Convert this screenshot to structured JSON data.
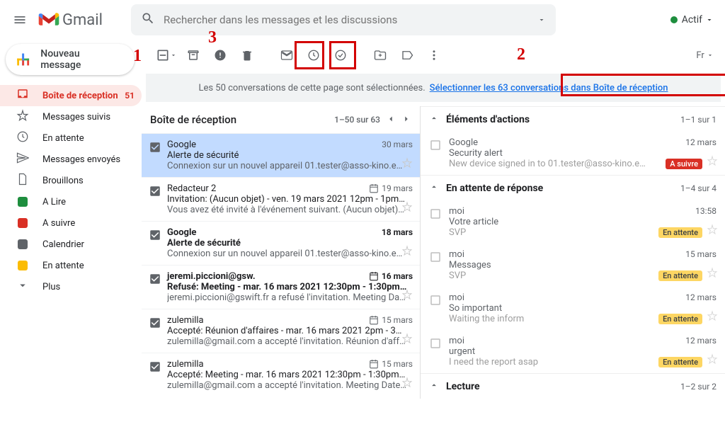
{
  "header": {
    "product": "Gmail",
    "search_placeholder": "Rechercher dans les messages et les discussions",
    "status_label": "Actif"
  },
  "compose_label": "Nouveau message",
  "nav": [
    {
      "label": "Boîte de réception",
      "count": "51",
      "active": true,
      "icon": "inbox"
    },
    {
      "label": "Messages suivis",
      "icon": "star"
    },
    {
      "label": "En attente",
      "icon": "clock"
    },
    {
      "label": "Messages envoyés",
      "icon": "send"
    },
    {
      "label": "Brouillons",
      "icon": "file"
    },
    {
      "label": "A Lire",
      "icon": "label",
      "color": "#1e8e3e"
    },
    {
      "label": "A suivre",
      "icon": "label",
      "color": "#d93025"
    },
    {
      "label": "Calendrier",
      "icon": "label",
      "color": "#5f6368"
    },
    {
      "label": "En attente",
      "icon": "label",
      "color": "#fbbc04"
    },
    {
      "label": "Plus",
      "icon": "more"
    }
  ],
  "toolbar_lang": "Fr",
  "banner": {
    "text": "Les 50 conversations de cette page sont sélectionnées.",
    "link": "Sélectionner les 63 conversations dans Boîte de réception"
  },
  "annotations": {
    "n1": "1",
    "n2": "2",
    "n3": "3"
  },
  "inbox": {
    "title": "Boîte de réception",
    "pager": "1–50 sur 63",
    "rows": [
      {
        "sender": "Google",
        "subject": "Alerte de sécurité",
        "snippet": "Connexion sur un nouvel appareil 01.tester@asso-kino.e…",
        "date": "30 mars",
        "selected": true,
        "read": true
      },
      {
        "sender": "Redacteur 2",
        "subject": "Invitation: (Aucun objet) - ven. 19 mars 2021 12pm - 1pm…",
        "snippet": "Vous avez été invité à l'événement suivant. (Aucun objet)…",
        "date": "19 mars",
        "cal": true,
        "read": true
      },
      {
        "sender": "Google",
        "subject": "Alerte de sécurité",
        "snippet": "Connexion sur un nouvel appareil 01.tester@asso-kino.e…",
        "date": "18 mars",
        "bold": true
      },
      {
        "sender": "jeremi.piccioni@gsw.",
        "subject": "Refusé: Meeting - mar. 16 mars 2021 12:30pm - 1:30pm…",
        "snippet": "jeremi.piccioni@gswift.fr a refusé l'invitation. Meeting Da…",
        "date": "16 mars",
        "cal": true,
        "bold": true
      },
      {
        "sender": "zulemilla",
        "subject": "Accepté: Réunion d'affaires - mar. 16 mars 2021 2pm - 3…",
        "snippet": "zulemilla@gmail.com a accepté l'invitation. Réunion d'aff…",
        "date": "15 mars",
        "cal": true,
        "read": true
      },
      {
        "sender": "zulemilla",
        "subject": "Accepté: Meeting - mar. 16 mars 2021 12:30pm - 1:30pm…",
        "snippet": "zulemilla@gmail.com a accepté l'invitation. Meeting Date…",
        "date": "15 mars",
        "cal": true,
        "read": true
      }
    ]
  },
  "side": {
    "groups": [
      {
        "title": "Éléments d'actions",
        "range": "1–1 sur 1",
        "rows": [
          {
            "sender": "Google",
            "subject": "Security alert",
            "snippet": "New device signed in to 01.tester@asso-kino.e…",
            "date": "12 mars",
            "badge": {
              "text": "A suivre",
              "cls": "red"
            }
          }
        ]
      },
      {
        "title": "En attente de réponse",
        "range": "1–4 sur 4",
        "rows": [
          {
            "sender": "moi",
            "subject": "Votre article",
            "snippet": "SVP",
            "date": "13:58",
            "badge": {
              "text": "En attente",
              "cls": "yellow"
            }
          },
          {
            "sender": "moi",
            "subject": "Messages",
            "snippet": "SVP",
            "date": "15 mars",
            "badge": {
              "text": "En attente",
              "cls": "yellow"
            }
          },
          {
            "sender": "moi",
            "subject": "So important",
            "snippet": "Waiting the inform",
            "date": "12 mars",
            "badge": {
              "text": "En attente",
              "cls": "yellow"
            }
          },
          {
            "sender": "moi",
            "subject": "urgent",
            "snippet": "I need the report asap",
            "date": "12 mars",
            "badge": {
              "text": "En attente",
              "cls": "yellow"
            }
          }
        ]
      },
      {
        "title": "Lecture",
        "range": "1–2 sur 2",
        "rows": []
      }
    ]
  }
}
